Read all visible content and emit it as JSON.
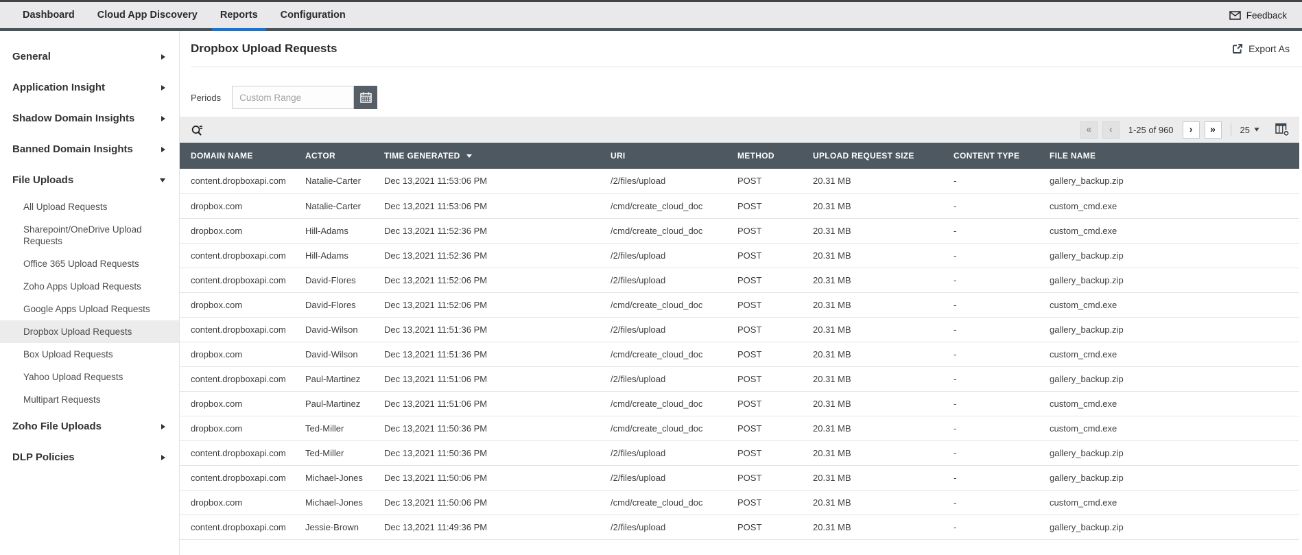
{
  "nav": {
    "items": [
      {
        "label": "Dashboard",
        "active": false
      },
      {
        "label": "Cloud App Discovery",
        "active": false
      },
      {
        "label": "Reports",
        "active": true
      },
      {
        "label": "Configuration",
        "active": false
      }
    ],
    "feedback": "Feedback"
  },
  "sidebar": {
    "sections": [
      {
        "label": "General"
      },
      {
        "label": "Application Insight"
      },
      {
        "label": "Shadow Domain Insights"
      },
      {
        "label": "Banned Domain Insights"
      },
      {
        "label": "File Uploads",
        "expanded": true,
        "children": [
          "All Upload Requests",
          "Sharepoint/OneDrive Upload Requests",
          "Office 365 Upload Requests",
          "Zoho Apps Upload Requests",
          "Google Apps Upload Requests",
          "Dropbox Upload Requests",
          "Box Upload Requests",
          "Yahoo Upload Requests",
          "Multipart Requests"
        ],
        "selected_child": "Dropbox Upload Requests"
      },
      {
        "label": "Zoho File Uploads"
      },
      {
        "label": "DLP Policies"
      }
    ]
  },
  "page": {
    "title": "Dropbox Upload Requests",
    "export_label": "Export As"
  },
  "filters": {
    "periods_label": "Periods",
    "custom_range_placeholder": "Custom Range",
    "custom_range_value": ""
  },
  "pagination": {
    "first_icon": "«",
    "prev_icon": "‹",
    "range": "1-25 of 960",
    "next_icon": "›",
    "last_icon": "»",
    "page_size": "25"
  },
  "table": {
    "columns": [
      "DOMAIN NAME",
      "ACTOR",
      "TIME GENERATED",
      "URI",
      "METHOD",
      "UPLOAD REQUEST SIZE",
      "CONTENT TYPE",
      "FILE NAME"
    ],
    "sorted_column": "TIME GENERATED",
    "sort_direction": "desc",
    "rows": [
      [
        "content.dropboxapi.com",
        "Natalie-Carter",
        "Dec 13,2021 11:53:06 PM",
        "/2/files/upload",
        "POST",
        "20.31 MB",
        "-",
        "gallery_backup.zip"
      ],
      [
        "dropbox.com",
        "Natalie-Carter",
        "Dec 13,2021 11:53:06 PM",
        "/cmd/create_cloud_doc",
        "POST",
        "20.31 MB",
        "-",
        "custom_cmd.exe"
      ],
      [
        "dropbox.com",
        "Hill-Adams",
        "Dec 13,2021 11:52:36 PM",
        "/cmd/create_cloud_doc",
        "POST",
        "20.31 MB",
        "-",
        "custom_cmd.exe"
      ],
      [
        "content.dropboxapi.com",
        "Hill-Adams",
        "Dec 13,2021 11:52:36 PM",
        "/2/files/upload",
        "POST",
        "20.31 MB",
        "-",
        "gallery_backup.zip"
      ],
      [
        "content.dropboxapi.com",
        "David-Flores",
        "Dec 13,2021 11:52:06 PM",
        "/2/files/upload",
        "POST",
        "20.31 MB",
        "-",
        "gallery_backup.zip"
      ],
      [
        "dropbox.com",
        "David-Flores",
        "Dec 13,2021 11:52:06 PM",
        "/cmd/create_cloud_doc",
        "POST",
        "20.31 MB",
        "-",
        "custom_cmd.exe"
      ],
      [
        "content.dropboxapi.com",
        "David-Wilson",
        "Dec 13,2021 11:51:36 PM",
        "/2/files/upload",
        "POST",
        "20.31 MB",
        "-",
        "gallery_backup.zip"
      ],
      [
        "dropbox.com",
        "David-Wilson",
        "Dec 13,2021 11:51:36 PM",
        "/cmd/create_cloud_doc",
        "POST",
        "20.31 MB",
        "-",
        "custom_cmd.exe"
      ],
      [
        "content.dropboxapi.com",
        "Paul-Martinez",
        "Dec 13,2021 11:51:06 PM",
        "/2/files/upload",
        "POST",
        "20.31 MB",
        "-",
        "gallery_backup.zip"
      ],
      [
        "dropbox.com",
        "Paul-Martinez",
        "Dec 13,2021 11:51:06 PM",
        "/cmd/create_cloud_doc",
        "POST",
        "20.31 MB",
        "-",
        "custom_cmd.exe"
      ],
      [
        "dropbox.com",
        "Ted-Miller",
        "Dec 13,2021 11:50:36 PM",
        "/cmd/create_cloud_doc",
        "POST",
        "20.31 MB",
        "-",
        "custom_cmd.exe"
      ],
      [
        "content.dropboxapi.com",
        "Ted-Miller",
        "Dec 13,2021 11:50:36 PM",
        "/2/files/upload",
        "POST",
        "20.31 MB",
        "-",
        "gallery_backup.zip"
      ],
      [
        "content.dropboxapi.com",
        "Michael-Jones",
        "Dec 13,2021 11:50:06 PM",
        "/2/files/upload",
        "POST",
        "20.31 MB",
        "-",
        "gallery_backup.zip"
      ],
      [
        "dropbox.com",
        "Michael-Jones",
        "Dec 13,2021 11:50:06 PM",
        "/cmd/create_cloud_doc",
        "POST",
        "20.31 MB",
        "-",
        "custom_cmd.exe"
      ],
      [
        "content.dropboxapi.com",
        "Jessie-Brown",
        "Dec 13,2021 11:49:36 PM",
        "/2/files/upload",
        "POST",
        "20.31 MB",
        "-",
        "gallery_backup.zip"
      ]
    ]
  },
  "colors": {
    "accent_blue": "#1473d6",
    "nav_bg": "#e9e9eb",
    "nav_bottom_strip": "#49535b",
    "table_header_bg": "#4e5860",
    "calendar_button_bg": "#565f68",
    "toolbar_bg": "#ececec",
    "selected_sidebar_bg": "#ececec"
  }
}
